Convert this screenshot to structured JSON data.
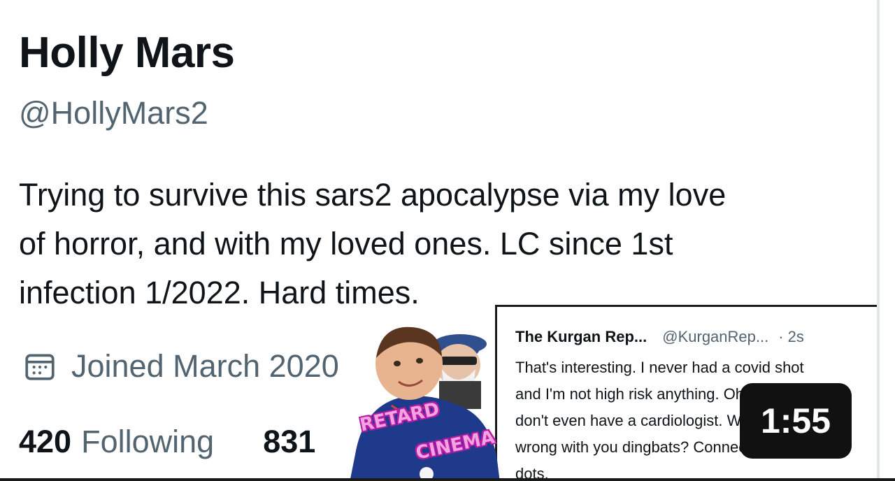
{
  "profile": {
    "display_name": "Holly Mars",
    "handle": "@HollyMars2",
    "bio_lines": [
      "Trying to survive this sars2 apocalypse via my love",
      "of horror, and with my loved ones. LC since 1st",
      "infection 1/2022. Hard times."
    ],
    "joined": "Joined March 2020",
    "following_count": "420",
    "following_label": "Following",
    "followers_count": "831"
  },
  "reply": {
    "name": "The Kurgan Rep...",
    "handle": "@KurganRep...",
    "time": "· 2s",
    "lines": [
      "That's interesting.  I never had a covid shot",
      "and I'm not high risk anything.  Oh and I",
      "don't even have a cardiologist. What's",
      "wrong with you dingbats? Connect some",
      "dots."
    ]
  },
  "sticker": {
    "line1": "RETARD",
    "line2": "CINEMA"
  },
  "video": {
    "duration": "1:55"
  },
  "icons": {
    "calendar": "calendar-icon"
  },
  "colors": {
    "primary_text": "#0f1419",
    "secondary_text": "#536471",
    "sticker_pink": "#f5a3e0"
  }
}
